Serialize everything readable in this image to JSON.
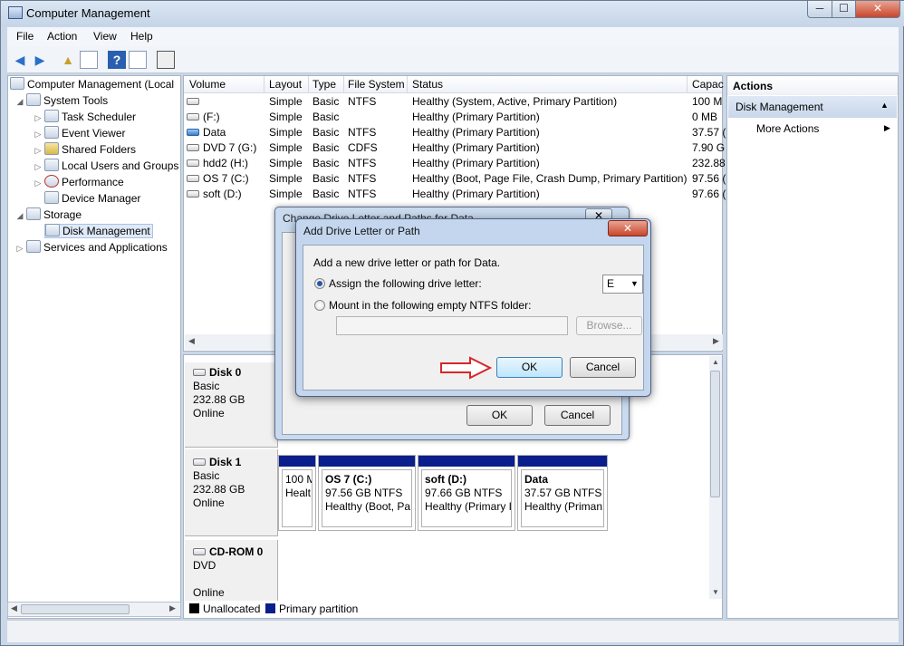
{
  "window": {
    "title": "Computer Management",
    "minimize": "─",
    "maximize": "☐",
    "close": "✕"
  },
  "menu": [
    "File",
    "Action",
    "View",
    "Help"
  ],
  "tree": {
    "root": "Computer Management (Local",
    "system_tools": "System Tools",
    "task_scheduler": "Task Scheduler",
    "event_viewer": "Event Viewer",
    "shared_folders": "Shared Folders",
    "local_users": "Local Users and Groups",
    "performance": "Performance",
    "device_manager": "Device Manager",
    "storage": "Storage",
    "disk_management": "Disk Management",
    "services": "Services and Applications"
  },
  "volume_list": {
    "headers": [
      "Volume",
      "Layout",
      "Type",
      "File System",
      "Status",
      "Capac"
    ],
    "rows": [
      {
        "volume": "",
        "layout": "Simple",
        "type": "Basic",
        "fs": "NTFS",
        "status": "Healthy (System, Active, Primary Partition)",
        "capacity": "100 M"
      },
      {
        "volume": "(F:)",
        "layout": "Simple",
        "type": "Basic",
        "fs": "",
        "status": "Healthy (Primary Partition)",
        "capacity": "0 MB"
      },
      {
        "volume": "Data",
        "layout": "Simple",
        "type": "Basic",
        "fs": "NTFS",
        "status": "Healthy (Primary Partition)",
        "capacity": "37.57 ("
      },
      {
        "volume": "DVD 7 (G:)",
        "layout": "Simple",
        "type": "Basic",
        "fs": "CDFS",
        "status": "Healthy (Primary Partition)",
        "capacity": "7.90 G"
      },
      {
        "volume": "hdd2 (H:)",
        "layout": "Simple",
        "type": "Basic",
        "fs": "NTFS",
        "status": "Healthy (Primary Partition)",
        "capacity": "232.88"
      },
      {
        "volume": "OS 7 (C:)",
        "layout": "Simple",
        "type": "Basic",
        "fs": "NTFS",
        "status": "Healthy (Boot, Page File, Crash Dump, Primary Partition)",
        "capacity": "97.56 ("
      },
      {
        "volume": "soft (D:)",
        "layout": "Simple",
        "type": "Basic",
        "fs": "NTFS",
        "status": "Healthy (Primary Partition)",
        "capacity": "97.66 ("
      }
    ]
  },
  "disks": {
    "disk0": {
      "name": "Disk 0",
      "type": "Basic",
      "size": "232.88 GB",
      "state": "Online"
    },
    "disk1": {
      "name": "Disk 1",
      "type": "Basic",
      "size": "232.88 GB",
      "state": "Online"
    },
    "cdrom0": {
      "name": "CD-ROM 0",
      "type": "DVD",
      "state": "Online"
    },
    "partitions": [
      {
        "name": "",
        "size": "100 M",
        "status": "Healt"
      },
      {
        "name": "OS 7  (C:)",
        "size": "97.56 GB NTFS",
        "status": "Healthy (Boot, Pa"
      },
      {
        "name": "soft  (D:)",
        "size": "97.66 GB NTFS",
        "status": "Healthy (Primary I"
      },
      {
        "name": "Data",
        "size": "37.57 GB NTFS",
        "status": "Healthy (Priman"
      }
    ]
  },
  "legend": {
    "unallocated": "Unallocated",
    "primary": "Primary partition",
    "unallocated_color": "#000000",
    "primary_color": "#0a1f8c"
  },
  "actions": {
    "header": "Actions",
    "section": "Disk Management",
    "more": "More Actions"
  },
  "back_dialog": {
    "title": "Change Drive Letter and Paths for Data",
    "ok": "OK",
    "cancel": "Cancel"
  },
  "dialog": {
    "title": "Add Drive Letter or Path",
    "intro": "Add a new drive letter or path for Data.",
    "assign_label": "Assign the following drive letter:",
    "drive_letter": "E",
    "mount_label": "Mount in the following empty NTFS folder:",
    "folder_value": "",
    "browse": "Browse...",
    "ok": "OK",
    "cancel": "Cancel",
    "close": "✕"
  }
}
